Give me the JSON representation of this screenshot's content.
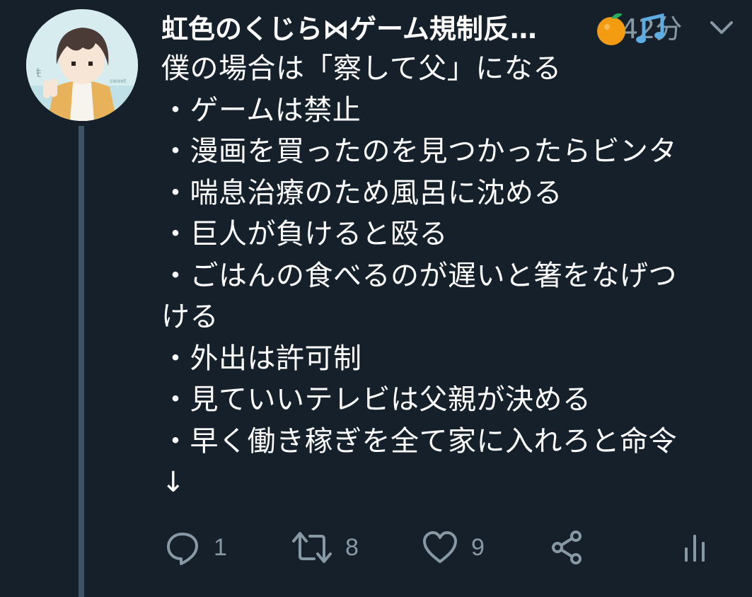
{
  "tweet": {
    "display_name": "虹色のくじら⋈ゲーム規制反…",
    "name_emoji": [
      "orange-icon",
      "music-notes-icon"
    ],
    "timestamp": "42分",
    "lines": [
      "僕の場合は「察して父」になる",
      "・ゲームは禁止",
      "・漫画を買ったのを見つかったらビンタ",
      "・喘息治療のため風呂に沈める",
      "・巨人が負けると殴る",
      "・ごはんの食べるのが遅いと箸をなげつ",
      "ける",
      "・外出は許可制",
      "・見ていいテレビは父親が決める",
      "・早く働き稼ぎを全て家に入れろと命令",
      "↓"
    ]
  },
  "actions": {
    "reply": {
      "icon": "reply-icon",
      "count": "1"
    },
    "retweet": {
      "icon": "retweet-icon",
      "count": "8"
    },
    "like": {
      "icon": "heart-icon",
      "count": "9"
    },
    "share": {
      "icon": "share-icon"
    },
    "analytics": {
      "icon": "analytics-icon"
    }
  },
  "colors": {
    "background": "#15202b",
    "text": "#ffffff",
    "secondary": "#8899a6",
    "thread_line": "#3d5466"
  }
}
